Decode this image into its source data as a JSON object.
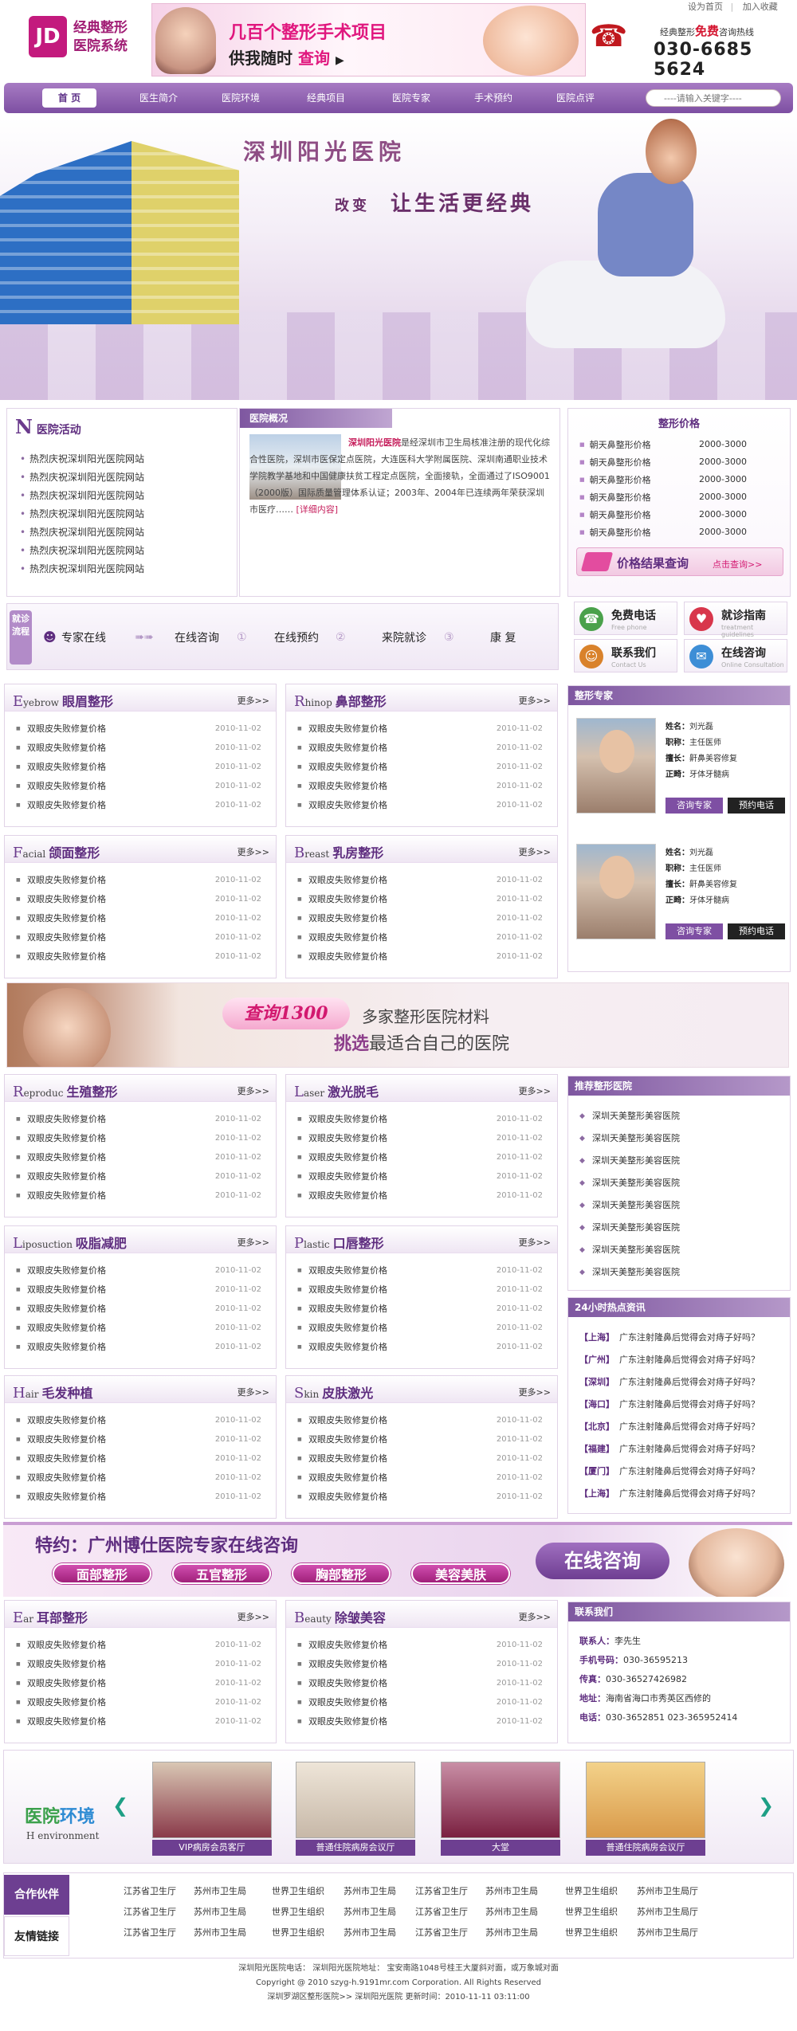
{
  "header": {
    "logo_mark": "JD",
    "logo_line1": "经典整形",
    "logo_line2": "医院系统",
    "ad_line1": "几百个整形手术项目",
    "ad_line2_a": "供我随时",
    "ad_line2_b": "查询",
    "ad_line2_arrow": "▶",
    "top_links": [
      "设为首页",
      "加入收藏"
    ],
    "hotline_prefix": "经典整形",
    "hotline_free": "免费",
    "hotline_suffix": "咨询热线",
    "hotline_number": "030-6685 5624",
    "phone_icon": "☎"
  },
  "nav": {
    "home": "首 页",
    "items": [
      "医生简介",
      "医院环境",
      "经典项目",
      "医院专家",
      "手术预约",
      "医院点评"
    ],
    "search_placeholder": "----请输入关键字----"
  },
  "hero": {
    "title": "深圳阳光医院",
    "slogan_small": "改变",
    "slogan_big": "让生活更经典"
  },
  "activities": {
    "title_initial": "N",
    "title": "医院活动",
    "items": [
      "热烈庆祝深圳阳光医院网站",
      "热烈庆祝深圳阳光医院网站",
      "热烈庆祝深圳阳光医院网站",
      "热烈庆祝深圳阳光医院网站",
      "热烈庆祝深圳阳光医院网站",
      "热烈庆祝深圳阳光医院网站",
      "热烈庆祝深圳阳光医院网站"
    ]
  },
  "overview": {
    "title": "医院概况",
    "highlight": "深圳阳光医院",
    "text": "是经深圳市卫生局核准注册的现代化综合性医院，深圳市医保定点医院，大连医科大学附属医院、深圳南通职业技术学院教学基地和中国健康扶贫工程定点医院，全面接轨，全面通过了ISO9001（2000版）国际质量管理体系认证；2003年、2004年已连续两年荣获深圳市医疗……",
    "more": "[详细内容]"
  },
  "prices": {
    "title": "整形价格",
    "rows": [
      {
        "name": "朝天鼻整形价格",
        "value": "2000-3000"
      },
      {
        "name": "朝天鼻整形价格",
        "value": "2000-3000"
      },
      {
        "name": "朝天鼻整形价格",
        "value": "2000-3000"
      },
      {
        "name": "朝天鼻整形价格",
        "value": "2000-3000"
      },
      {
        "name": "朝天鼻整形价格",
        "value": "2000-3000"
      },
      {
        "name": "朝天鼻整形价格",
        "value": "2000-3000"
      }
    ],
    "query_label": "价格结果查询",
    "query_click": "点击查询>>"
  },
  "process": {
    "tag": "就诊流程",
    "steps": [
      "专家在线",
      "在线咨询",
      "在线预约",
      "来院就诊",
      "康 复"
    ]
  },
  "services": [
    {
      "name": "免费电话",
      "en": "Free phone",
      "icon": "☎",
      "color": "#4aa14b"
    },
    {
      "name": "就诊指南",
      "en": "treatment guidelines",
      "icon": "♥",
      "color": "#d8364b"
    },
    {
      "name": "联系我们",
      "en": "Contact Us",
      "icon": "☺",
      "color": "#d9822b"
    },
    {
      "name": "在线咨询",
      "en": "Online Consultation",
      "icon": "✉",
      "color": "#3d8ed6"
    }
  ],
  "item_title": "双眼皮失败修复价格",
  "item_date": "2010-11-02",
  "more_label": "更多>>",
  "categories": [
    {
      "initial": "E",
      "en": "yebrow",
      "zh": "眼眉整形"
    },
    {
      "initial": "R",
      "en": "hinop",
      "zh": "鼻部整形"
    },
    {
      "initial": "F",
      "en": "acial",
      "zh": "颌面整形"
    },
    {
      "initial": "B",
      "en": "reast",
      "zh": "乳房整形"
    },
    {
      "initial": "R",
      "en": "eproduc",
      "zh": "生殖整形"
    },
    {
      "initial": "L",
      "en": "aser",
      "zh": "激光脱毛"
    },
    {
      "initial": "L",
      "en": "iposuction",
      "zh": "吸脂减肥"
    },
    {
      "initial": "P",
      "en": "lastic",
      "zh": "口唇整形"
    },
    {
      "initial": "H",
      "en": "air",
      "zh": "毛发种植"
    },
    {
      "initial": "S",
      "en": "kin",
      "zh": "皮肤激光"
    },
    {
      "initial": "E",
      "en": "ar",
      "zh": "耳部整形"
    },
    {
      "initial": "B",
      "en": "eauty",
      "zh": "除皱美容"
    }
  ],
  "experts": {
    "title": "整形专家",
    "labels": {
      "name": "姓名：",
      "title": "职称：",
      "skill": "擅长：",
      "good": "正畸："
    },
    "list": [
      {
        "name": "刘光磊",
        "title": "主任医师",
        "skill": "鼾鼻美容修复",
        "good": "牙体牙髓病"
      },
      {
        "name": "刘光磊",
        "title": "主任医师",
        "skill": "鼾鼻美容修复",
        "good": "牙体牙髓病"
      }
    ],
    "btn_consult": "咨询专家",
    "btn_book": "预约电话"
  },
  "banner1": {
    "pill": "查询1300",
    "line1": "多家整形医院材料",
    "line2_a": "挑选",
    "line2_b": "最适合自己的医院"
  },
  "recommend": {
    "title": "推荐整形医院",
    "items": [
      "深圳天美整形美容医院",
      "深圳天美整形美容医院",
      "深圳天美整形美容医院",
      "深圳天美整形美容医院",
      "深圳天美整形美容医院",
      "深圳天美整形美容医院",
      "深圳天美整形美容医院",
      "深圳天美整形美容医院"
    ]
  },
  "hot": {
    "title": "24小时热点资讯",
    "items": [
      {
        "city": "【上海】",
        "text": "广东注射隆鼻后觉得会对痔子好吗？"
      },
      {
        "city": "【广州】",
        "text": "广东注射隆鼻后觉得会对痔子好吗？"
      },
      {
        "city": "【深圳】",
        "text": "广东注射隆鼻后觉得会对痔子好吗？"
      },
      {
        "city": "【海口】",
        "text": "广东注射隆鼻后觉得会对痔子好吗？"
      },
      {
        "city": "【北京】",
        "text": "广东注射隆鼻后觉得会对痔子好吗？"
      },
      {
        "city": "【福建】",
        "text": "广东注射隆鼻后觉得会对痔子好吗？"
      },
      {
        "city": "【厦门】",
        "text": "广东注射隆鼻后觉得会对痔子好吗？"
      },
      {
        "city": "【上海】",
        "text": "广东注射隆鼻后觉得会对痔子好吗？"
      }
    ]
  },
  "banner2": {
    "title": "特约：广州博仕医院专家在线咨询",
    "buttons": [
      "面部整形",
      "五官整形",
      "胸部整形",
      "美容美肤"
    ],
    "big": "在线咨询"
  },
  "contact": {
    "title": "联系我们",
    "rows": [
      {
        "label": "联系人：",
        "value": "李先生"
      },
      {
        "label": "手机号码：",
        "value": "030-36595213"
      },
      {
        "label": "传真：",
        "value": "030-36527426982"
      },
      {
        "label": "地址：",
        "value": "海南省海口市秀英区西修的"
      },
      {
        "label": "电话：",
        "value": "030-3652851    023-365952414"
      }
    ]
  },
  "environment": {
    "title_a": "医院",
    "title_b": "环境",
    "en": "H environment",
    "items": [
      {
        "caption": "VIP病房会员客厅",
        "color": "#8a3a4a"
      },
      {
        "caption": "普通住院病房会议厅",
        "color": "#c7b8a8"
      },
      {
        "caption": "大堂",
        "color": "#7a2040"
      },
      {
        "caption": "普通住院病房会议厅",
        "color": "#d99a4a"
      }
    ]
  },
  "links": {
    "tab1": "合作伙伴",
    "tab2": "友情链接",
    "rows": [
      [
        "江苏省卫生厅",
        "苏州市卫生局",
        "世界卫生组织",
        "苏州市卫生局",
        "江苏省卫生厅",
        "苏州市卫生局",
        "世界卫生组织",
        "苏州市卫生局厅"
      ],
      [
        "江苏省卫生厅",
        "苏州市卫生局",
        "世界卫生组织",
        "苏州市卫生局",
        "江苏省卫生厅",
        "苏州市卫生局",
        "世界卫生组织",
        "苏州市卫生局厅"
      ],
      [
        "江苏省卫生厅",
        "苏州市卫生局",
        "世界卫生组织",
        "苏州市卫生局",
        "江苏省卫生厅",
        "苏州市卫生局",
        "世界卫生组织",
        "苏州市卫生局厅"
      ]
    ]
  },
  "footer": {
    "line1": "深圳阳光医院电话： 深圳阳光医院地址： 宝安南路1048号桂王大厦斜对面，或万象城对面",
    "line2": "Copyright @ 2010 szyg-h.9191mr.com Corporation. All Rights Reserved",
    "line3": "深圳罗湖区整形医院>>  深圳阳光医院  更新时间：2010-11-11 03:11:00"
  }
}
